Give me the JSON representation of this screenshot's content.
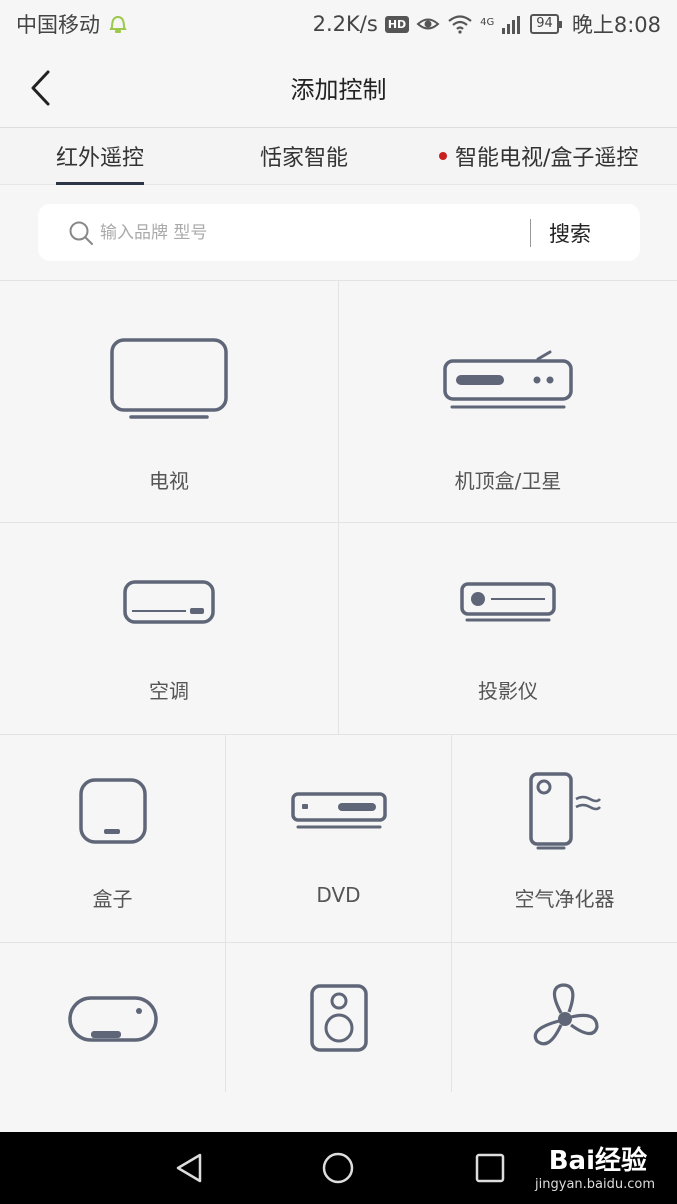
{
  "status_bar": {
    "carrier": "中国移动",
    "speed": "2.2K/s",
    "hd": "HD",
    "network": "4G",
    "battery": "94",
    "time": "晚上8:08"
  },
  "header": {
    "title": "添加控制"
  },
  "tabs": [
    {
      "label": "红外遥控",
      "active": true
    },
    {
      "label": "恬家智能",
      "active": false
    },
    {
      "label": "智能电视/盒子遥控",
      "active": false,
      "dot": true
    }
  ],
  "search": {
    "placeholder": "输入品牌 型号",
    "value": "",
    "button": "搜索"
  },
  "devices": {
    "row1": [
      {
        "label": "电视",
        "icon": "tv-icon"
      },
      {
        "label": "机顶盒/卫星",
        "icon": "set-top-box-icon"
      }
    ],
    "row2": [
      {
        "label": "空调",
        "icon": "air-conditioner-icon"
      },
      {
        "label": "投影仪",
        "icon": "projector-icon"
      }
    ],
    "row3": [
      {
        "label": "盒子",
        "icon": "box-icon"
      },
      {
        "label": "DVD",
        "icon": "dvd-icon"
      },
      {
        "label": "空气净化器",
        "icon": "air-purifier-icon"
      }
    ],
    "row4": [
      {
        "label": "",
        "icon": "water-heater-icon"
      },
      {
        "label": "",
        "icon": "speaker-icon"
      },
      {
        "label": "",
        "icon": "fan-icon"
      }
    ]
  },
  "watermark": {
    "brand": "Bai经验",
    "url": "jingyan.baidu.com"
  },
  "colors": {
    "icon_stroke": "#5f6678",
    "tab_underline": "#2c3447",
    "dot": "#c91f1f"
  }
}
